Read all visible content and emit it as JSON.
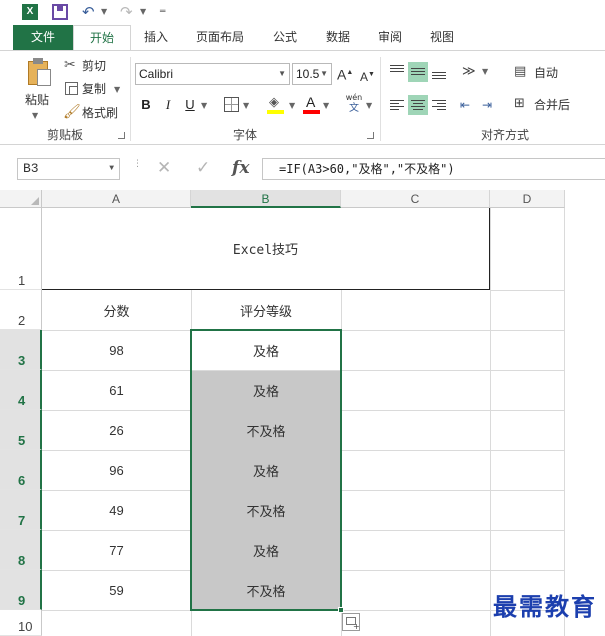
{
  "qat": {
    "app_icon": "excel-logo",
    "app_letter": "X",
    "save_icon": "save-icon",
    "undo_icon": "undo-icon",
    "redo_icon": "redo-icon",
    "customize_icon": "customize-qat-icon"
  },
  "tabs": [
    {
      "label": "文件",
      "active": false
    },
    {
      "label": "开始",
      "active": true
    },
    {
      "label": "插入",
      "active": false
    },
    {
      "label": "页面布局",
      "active": false
    },
    {
      "label": "公式",
      "active": false
    },
    {
      "label": "数据",
      "active": false
    },
    {
      "label": "审阅",
      "active": false
    },
    {
      "label": "视图",
      "active": false
    }
  ],
  "ribbon": {
    "clipboard": {
      "paste_label": "粘贴",
      "cut_label": "剪切",
      "copy_label": "复制",
      "painter_label": "格式刷",
      "group_label": "剪贴板"
    },
    "font": {
      "font_name": "Calibri",
      "font_size": "10.5",
      "grow_label": "A",
      "shrink_label": "A",
      "bold_label": "B",
      "italic_label": "I",
      "underline_label": "U",
      "font_color_label": "A",
      "phonetic_top": "wén",
      "phonetic_bottom": "文",
      "fill_color": "#ffff00",
      "font_color": "#ff0000",
      "group_label": "字体"
    },
    "alignment": {
      "wrap_label": "自动",
      "merge_label": "合并后",
      "group_label": "对齐方式"
    }
  },
  "formula_bar": {
    "name_box": "B3",
    "formula": "=IF(A3>60,\"及格\",\"不及格\")"
  },
  "sheet": {
    "columns": [
      "A",
      "B",
      "C",
      "D"
    ],
    "selected_column": "B",
    "rows": [
      "1",
      "2",
      "3",
      "4",
      "5",
      "6",
      "7",
      "8",
      "9",
      "10"
    ],
    "selected_rows": [
      "3",
      "4",
      "5",
      "6",
      "7",
      "8",
      "9"
    ],
    "title": "Excel技巧",
    "header_a": "分数",
    "header_b": "评分等级",
    "data": [
      {
        "score": "98",
        "grade": "及格"
      },
      {
        "score": "61",
        "grade": "及格"
      },
      {
        "score": "26",
        "grade": "不及格"
      },
      {
        "score": "96",
        "grade": "及格"
      },
      {
        "score": "49",
        "grade": "不及格"
      },
      {
        "score": "77",
        "grade": "及格"
      },
      {
        "score": "59",
        "grade": "不及格"
      }
    ],
    "selection_fill": "#c8c8c8",
    "selection_border": "#217346",
    "quick_analysis_icon": "quick-analysis-icon"
  },
  "watermark": "最需教育"
}
